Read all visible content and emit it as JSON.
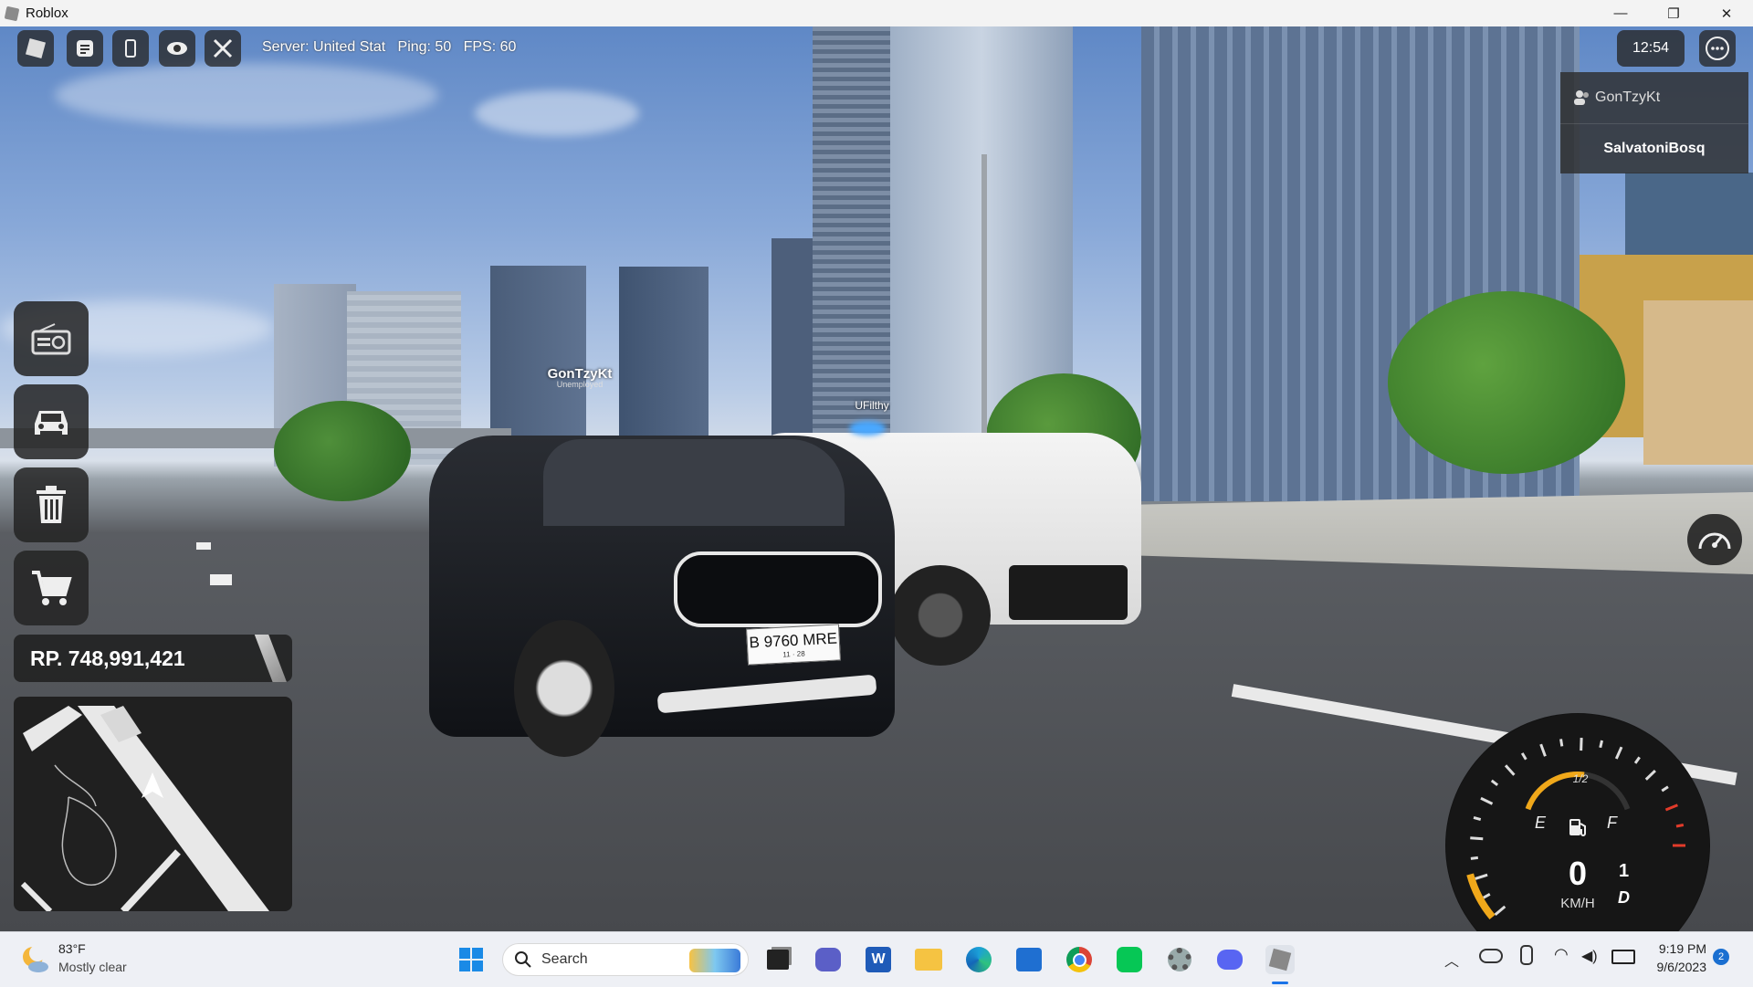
{
  "window": {
    "title": "Roblox",
    "minimize": "—",
    "restore": "❐",
    "close": "✕"
  },
  "hud": {
    "server_info": "Server: United Stat",
    "ping": "Ping: 50",
    "fps": "FPS: 60",
    "clock": "12:54",
    "menu_icon": "ellipsis-icon"
  },
  "player_list": {
    "local_player": "GonTzyKt",
    "players": [
      "SalvatoniBosq"
    ]
  },
  "world_labels": {
    "player_tag_name": "GonTzyKt",
    "player_tag_job": "Unemployed",
    "other_player_name": "UFilthy",
    "plate_main": "B 9760 MRE",
    "plate_sub": "11 · 28"
  },
  "side_menu": {
    "icons": [
      "radio-icon",
      "car-icon",
      "trash-icon",
      "cart-icon"
    ]
  },
  "money": {
    "label": "RP. 748,991,421"
  },
  "speedometer": {
    "speed": "0",
    "unit": "KM/H",
    "gear_number": "1",
    "gear_mode": "D",
    "fuel_empty": "E",
    "fuel_half": "1/2",
    "fuel_full": "F",
    "fuel_level": 0.55
  },
  "taskbar": {
    "weather_temp": "83°F",
    "weather_desc": "Mostly clear",
    "search_placeholder": "Search",
    "time": "9:19 PM",
    "date": "9/6/2023",
    "notifications": "2"
  },
  "colors": {
    "hud_panel": "#2b2b2b",
    "accent_yellow": "#f0a81a",
    "gauge_red": "#e23b2a",
    "taskbar_bg": "#eef0f5"
  }
}
